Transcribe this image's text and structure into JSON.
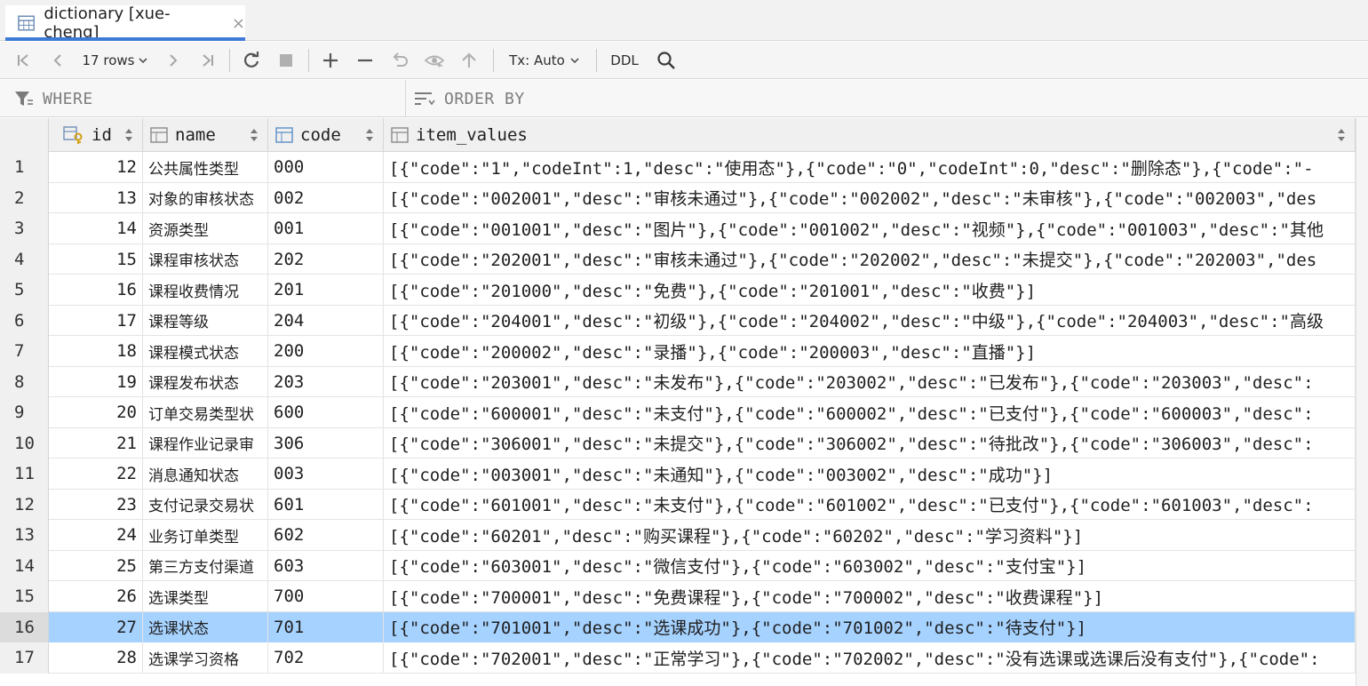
{
  "tab": {
    "title": "dictionary [xue-cheng]",
    "close_glyph": "×"
  },
  "toolbar": {
    "rows_label": "17 rows",
    "tx_label": "Tx: Auto",
    "ddl_label": "DDL"
  },
  "filter": {
    "where_label": "WHERE",
    "order_label": "ORDER BY"
  },
  "columns": {
    "id": "id",
    "name": "name",
    "code": "code",
    "item_values": "item_values"
  },
  "rows": [
    {
      "num": "1",
      "id": "12",
      "name": "公共属性类型",
      "code": "000",
      "item_values": "[{\"code\":\"1\",\"codeInt\":1,\"desc\":\"使用态\"},{\"code\":\"0\",\"codeInt\":0,\"desc\":\"删除态\"},{\"code\":\"-"
    },
    {
      "num": "2",
      "id": "13",
      "name": "对象的审核状态",
      "code": "002",
      "item_values": "[{\"code\":\"002001\",\"desc\":\"审核未通过\"},{\"code\":\"002002\",\"desc\":\"未审核\"},{\"code\":\"002003\",\"des"
    },
    {
      "num": "3",
      "id": "14",
      "name": "资源类型",
      "code": "001",
      "item_values": "[{\"code\":\"001001\",\"desc\":\"图片\"},{\"code\":\"001002\",\"desc\":\"视频\"},{\"code\":\"001003\",\"desc\":\"其他"
    },
    {
      "num": "4",
      "id": "15",
      "name": "课程审核状态",
      "code": "202",
      "item_values": "[{\"code\":\"202001\",\"desc\":\"审核未通过\"},{\"code\":\"202002\",\"desc\":\"未提交\"},{\"code\":\"202003\",\"des"
    },
    {
      "num": "5",
      "id": "16",
      "name": "课程收费情况",
      "code": "201",
      "item_values": "[{\"code\":\"201000\",\"desc\":\"免费\"},{\"code\":\"201001\",\"desc\":\"收费\"}]"
    },
    {
      "num": "6",
      "id": "17",
      "name": "课程等级",
      "code": "204",
      "item_values": "[{\"code\":\"204001\",\"desc\":\"初级\"},{\"code\":\"204002\",\"desc\":\"中级\"},{\"code\":\"204003\",\"desc\":\"高级"
    },
    {
      "num": "7",
      "id": "18",
      "name": "课程模式状态",
      "code": "200",
      "item_values": "[{\"code\":\"200002\",\"desc\":\"录播\"},{\"code\":\"200003\",\"desc\":\"直播\"}]"
    },
    {
      "num": "8",
      "id": "19",
      "name": "课程发布状态",
      "code": "203",
      "item_values": "[{\"code\":\"203001\",\"desc\":\"未发布\"},{\"code\":\"203002\",\"desc\":\"已发布\"},{\"code\":\"203003\",\"desc\":"
    },
    {
      "num": "9",
      "id": "20",
      "name": "订单交易类型状",
      "code": "600",
      "item_values": "[{\"code\":\"600001\",\"desc\":\"未支付\"},{\"code\":\"600002\",\"desc\":\"已支付\"},{\"code\":\"600003\",\"desc\":"
    },
    {
      "num": "10",
      "id": "21",
      "name": "课程作业记录审",
      "code": "306",
      "item_values": "[{\"code\":\"306001\",\"desc\":\"未提交\"},{\"code\":\"306002\",\"desc\":\"待批改\"},{\"code\":\"306003\",\"desc\":"
    },
    {
      "num": "11",
      "id": "22",
      "name": "消息通知状态",
      "code": "003",
      "item_values": "[{\"code\":\"003001\",\"desc\":\"未通知\"},{\"code\":\"003002\",\"desc\":\"成功\"}]"
    },
    {
      "num": "12",
      "id": "23",
      "name": "支付记录交易状",
      "code": "601",
      "item_values": "[{\"code\":\"601001\",\"desc\":\"未支付\"},{\"code\":\"601002\",\"desc\":\"已支付\"},{\"code\":\"601003\",\"desc\":"
    },
    {
      "num": "13",
      "id": "24",
      "name": "业务订单类型",
      "code": "602",
      "item_values": "[{\"code\":\"60201\",\"desc\":\"购买课程\"},{\"code\":\"60202\",\"desc\":\"学习资料\"}]"
    },
    {
      "num": "14",
      "id": "25",
      "name": "第三方支付渠道",
      "code": "603",
      "item_values": "[{\"code\":\"603001\",\"desc\":\"微信支付\"},{\"code\":\"603002\",\"desc\":\"支付宝\"}]"
    },
    {
      "num": "15",
      "id": "26",
      "name": "选课类型",
      "code": "700",
      "item_values": "[{\"code\":\"700001\",\"desc\":\"免费课程\"},{\"code\":\"700002\",\"desc\":\"收费课程\"}]"
    },
    {
      "num": "16",
      "id": "27",
      "name": "选课状态",
      "code": "701",
      "item_values": "[{\"code\":\"701001\",\"desc\":\"选课成功\"},{\"code\":\"701002\",\"desc\":\"待支付\"}]",
      "selected": true
    },
    {
      "num": "17",
      "id": "28",
      "name": "选课学习资格",
      "code": "702",
      "item_values": "[{\"code\":\"702001\",\"desc\":\"正常学习\"},{\"code\":\"702002\",\"desc\":\"没有选课或选课后没有支付\"},{\"code\":"
    }
  ],
  "colors": {
    "accent": "#3d7bd6",
    "selection": "#a6d2ff",
    "header_bg": "#f0f0f0"
  }
}
